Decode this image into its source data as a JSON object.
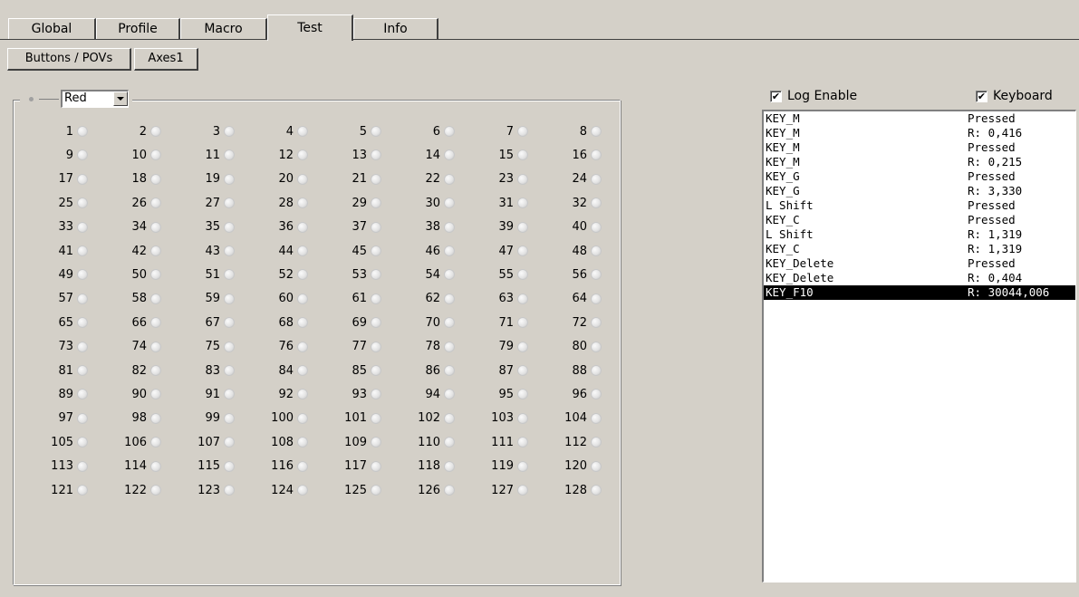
{
  "tabs": [
    {
      "label": "Global"
    },
    {
      "label": "Profile"
    },
    {
      "label": "Macro"
    },
    {
      "label": "Test",
      "active": true
    },
    {
      "label": "Info"
    }
  ],
  "subtabs": [
    {
      "label": "Buttons / POVs",
      "active": true
    },
    {
      "label": "Axes1"
    }
  ],
  "color_select": {
    "value": "Red"
  },
  "buttons_start": 1,
  "buttons_end": 128,
  "columns": 8,
  "log_enable": {
    "label": "Log Enable",
    "checked": true
  },
  "keyboard": {
    "label": "Keyboard",
    "checked": true
  },
  "log": [
    {
      "key": "KEY_M",
      "value": "Pressed"
    },
    {
      "key": "KEY_M",
      "value": "R: 0,416"
    },
    {
      "key": "KEY_M",
      "value": "Pressed"
    },
    {
      "key": "KEY_M",
      "value": "R: 0,215"
    },
    {
      "key": "KEY_G",
      "value": "Pressed"
    },
    {
      "key": "KEY_G",
      "value": "R: 3,330"
    },
    {
      "key": "L Shift",
      "value": "Pressed"
    },
    {
      "key": "KEY_C",
      "value": "Pressed"
    },
    {
      "key": "L Shift",
      "value": "R: 1,319"
    },
    {
      "key": "KEY_C",
      "value": "R: 1,319"
    },
    {
      "key": "KEY_Delete",
      "value": "Pressed"
    },
    {
      "key": "KEY_Delete",
      "value": "R: 0,404"
    },
    {
      "key": "KEY_F10",
      "value": "R: 30044,006",
      "selected": true
    }
  ],
  "check_glyph": "✔"
}
